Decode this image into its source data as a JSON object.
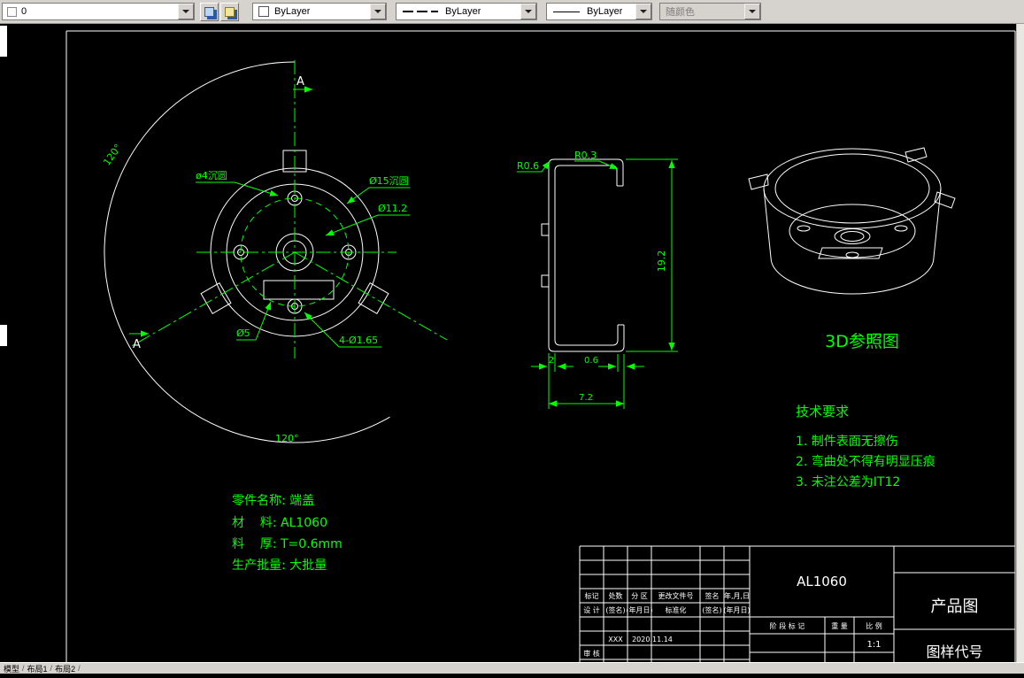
{
  "toolbar": {
    "layer_value": "0",
    "color_value": "ByLayer",
    "linetype_value": "ByLayer",
    "lineweight_value": "ByLayer",
    "plotstyle_value": "随颜色"
  },
  "tabs": {
    "model": "模型",
    "layout1": "布局1",
    "layout2": "布局2"
  },
  "front_view": {
    "section_label_top": "A",
    "section_label_bottom": "A",
    "angle_upper": "120°",
    "angle_lower": "120°",
    "dim_counterbore_small": "ø4沉圆",
    "dim_counterbore_large": "Ø15沉圆",
    "dim_center_hole": "Ø11.2",
    "dim_slot": "Ø5",
    "dim_small_holes": "4-Ø1.65"
  },
  "section_view": {
    "dim_r_left": "R0.6",
    "dim_r_right": "R0.3",
    "dim_height": "19.2",
    "dim_notch": "2",
    "dim_thickness": "0.6",
    "dim_width": "7.2"
  },
  "iso_view": {
    "caption": "3D参照图"
  },
  "tech_req": {
    "title": "技术要求",
    "item1": "1. 制件表面无擦伤",
    "item2": "2. 弯曲处不得有明显压痕",
    "item3": "3. 未注公差为IT12"
  },
  "part_info": {
    "line1": "零件名称: 端盖",
    "line2": "材    料: AL1060",
    "line3": "料    厚: T=0.6mm",
    "line4": "生产批量: 大批量"
  },
  "title_block": {
    "material": "AL1060",
    "product": "产品图",
    "code": "图样代号",
    "scale_value": "1:1",
    "h_mark": "标记",
    "h_count": "处数",
    "h_zone": "分 区",
    "h_file": "更改文件号",
    "h_sign": "签名",
    "h_date": "年,月,日",
    "r_design": "设 计",
    "r_sign1": "(签名)",
    "r_date1": "(年月日)",
    "r_std": "标准化",
    "r_sign2": "(签名)",
    "r_date2": "(年月日)",
    "designer": "XXX",
    "design_date": "2020.11.14",
    "r_audit": "审 核",
    "stage": "阶 段 标 记",
    "weight": "重 量",
    "scale_label": "比 例"
  }
}
